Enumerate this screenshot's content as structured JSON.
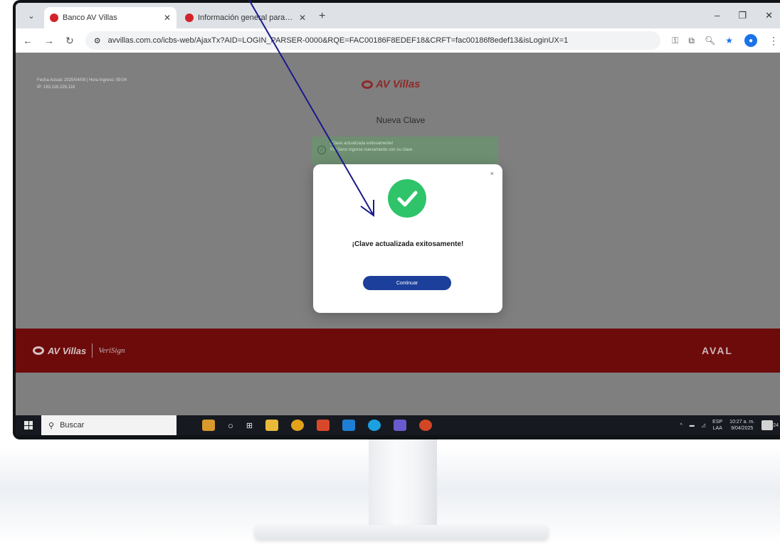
{
  "browser": {
    "tabs": [
      {
        "title": "Banco AV Villas",
        "active": true
      },
      {
        "title": "Información general para tu en",
        "active": false
      }
    ],
    "address_url": "avvillas.com.co/icbs-web/AjaxTx?AID=LOGIN_PARSER-0000&RQE=FAC00186F8EDEF18&CRFT=fac00186f8edef13&isLoginUX=1"
  },
  "page": {
    "meta_line1": "Fecha Actual: 2025/04/09 | Hora Ingreso: 09:04",
    "meta_line2": "IP: 163.116.226.116",
    "logo_text": "AV Villas",
    "title": "Nueva Clave",
    "notice_line1": "¡Clave actualizada exitosamente!",
    "notice_line2": "Por favor ingrese nuevamente con su clave"
  },
  "modal": {
    "close_symbol": "×",
    "message": "¡Clave actualizada exitosamente!",
    "button_label": "Continuar"
  },
  "footer": {
    "logo_text": "AV Villas",
    "verisign_text": "VeriSign",
    "aval_text": "AVAL"
  },
  "taskbar": {
    "search_label": "Buscar",
    "lang_top": "ESP",
    "lang_bottom": "LAA",
    "time": "10:27 a. m.",
    "date": "9/04/2025",
    "notification_count": "24"
  },
  "colors": {
    "brand_red": "#d2232a",
    "success_green": "#2fc46a",
    "button_blue": "#1b3f9a",
    "annotation_arrow": "#1a1a8c"
  },
  "icons": [
    "search-icon",
    "check-icon",
    "close-icon",
    "windows-logo-icon",
    "star-icon",
    "back-icon",
    "forward-icon",
    "reload-icon"
  ]
}
